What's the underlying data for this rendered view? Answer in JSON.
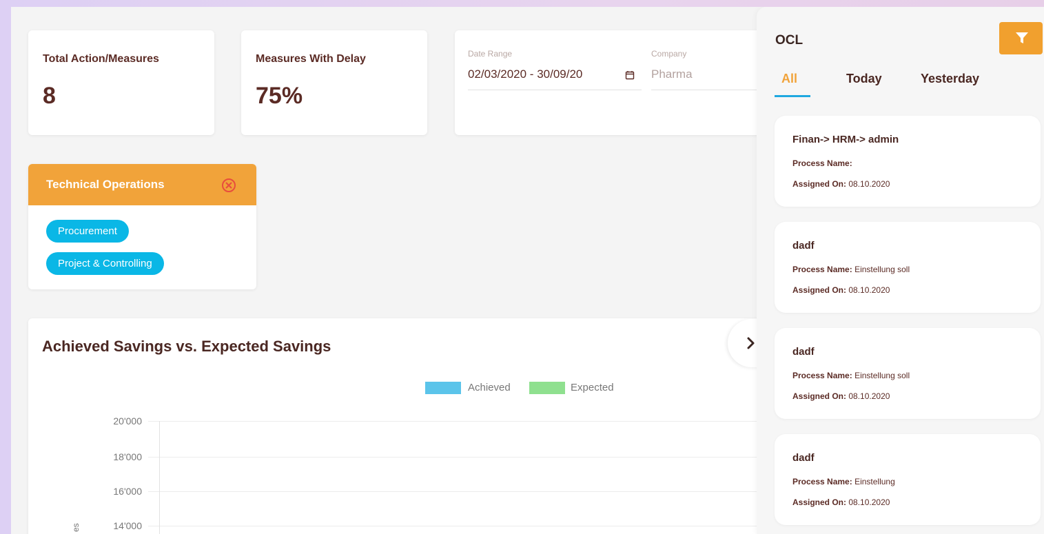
{
  "stats": [
    {
      "title": "Total Action/Measures",
      "value": "8"
    },
    {
      "title": "Measures With Delay",
      "value": "75%"
    }
  ],
  "filters": {
    "date_label": "Date Range",
    "date_value": "02/03/2020 - 30/09/20",
    "company_label": "Company",
    "company_value": "Pharma"
  },
  "category_card": {
    "title": "Technical Operations",
    "tags": [
      "Procurement",
      "Project & Controlling"
    ]
  },
  "chart": {
    "title": "Achieved Savings vs. Expected Savings",
    "ylabel_fragment": "es"
  },
  "chart_data": {
    "type": "bar",
    "title": "Achieved Savings vs. Expected Savings",
    "legend": [
      "Achieved",
      "Expected"
    ],
    "legend_placement": "top-center",
    "series": [
      {
        "name": "Achieved",
        "values": []
      },
      {
        "name": "Expected",
        "values": []
      }
    ],
    "yticks": [
      "20'000",
      "18'000",
      "16'000",
      "14'000"
    ],
    "ylim_visible": [
      14000,
      20000
    ],
    "grid": true,
    "colors": {
      "Achieved": "#5bc4ea",
      "Expected": "#8fe08f"
    }
  },
  "panel": {
    "title": "OCL",
    "tabs": [
      "All",
      "Today",
      "Yesterday"
    ],
    "active_tab": "All",
    "filter_icon": "filter-icon",
    "process_label": "Process Name:",
    "assigned_label": "Assigned On:",
    "tasks": [
      {
        "title": "Finan-> HRM-> admin",
        "process": "",
        "assigned": "08.10.2020"
      },
      {
        "title": "dadf",
        "process": "Einstellung soll",
        "assigned": "08.10.2020"
      },
      {
        "title": "dadf",
        "process": "Einstellung soll",
        "assigned": "08.10.2020"
      },
      {
        "title": "dadf",
        "process": "Einstellung",
        "assigned": "08.10.2020"
      }
    ]
  },
  "colors": {
    "accent_orange": "#f1a33a",
    "tag_blue": "#0ab7e6",
    "tab_underline": "#1fa8e0",
    "text_brown": "#5b2b25"
  }
}
